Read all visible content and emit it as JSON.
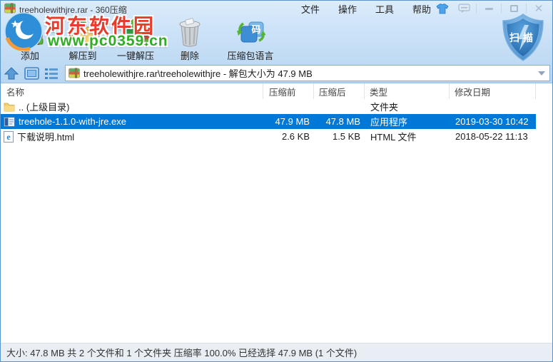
{
  "window": {
    "title": "treeholewithjre.rar - 360压缩",
    "menus": [
      {
        "label": "文件"
      },
      {
        "label": "操作"
      },
      {
        "label": "工具"
      },
      {
        "label": "帮助"
      }
    ]
  },
  "toolbar": {
    "items": [
      {
        "label": "添加",
        "icon": "add-archive-icon"
      },
      {
        "label": "解压到",
        "icon": "extract-to-icon"
      },
      {
        "label": "一键解压",
        "icon": "one-key-extract-icon"
      },
      {
        "label": "删除",
        "icon": "delete-icon"
      },
      {
        "label": "压缩包语言",
        "icon": "archive-language-icon",
        "icon_char": "码"
      }
    ],
    "scan_label": "扫描"
  },
  "addressbar": {
    "value": "treeholewithjre.rar\\treeholewithjre - 解包大小为 47.9 MB"
  },
  "filelist": {
    "columns": [
      "名称",
      "压缩前",
      "压缩后",
      "类型",
      "修改日期"
    ],
    "rows": [
      {
        "name": ".. (上级目录)",
        "size_before": "",
        "size_after": "",
        "type": "文件夹",
        "modified": "",
        "icon": "folder-icon",
        "selected": false
      },
      {
        "name": "treehole-1.1.0-with-jre.exe",
        "size_before": "47.9 MB",
        "size_after": "47.8 MB",
        "type": "应用程序",
        "modified": "2019-03-30 10:42",
        "icon": "exe-file-icon",
        "selected": true
      },
      {
        "name": "下载说明.html",
        "size_before": "2.6 KB",
        "size_after": "1.5 KB",
        "type": "HTML 文件",
        "modified": "2018-05-22 11:13",
        "icon": "html-file-icon",
        "selected": false
      }
    ]
  },
  "statusbar": {
    "text": "大小: 47.8 MB 共 2 个文件和 1 个文件夹 压缩率 100.0% 已经选择 47.9 MB (1 个文件)"
  },
  "watermark": {
    "line1": "河东软件园",
    "line2": "www.pc0359.cn",
    "line1_color": "#e63c2b",
    "line2_color": "#2fae24"
  },
  "colors": {
    "selection_blue": "#0078d7",
    "chrome_blue_top": "#dcecfb",
    "chrome_blue_bottom": "#b7d5f1",
    "statusbar_bg": "#e8eef4",
    "shield_blue": "#2f7bc4"
  }
}
